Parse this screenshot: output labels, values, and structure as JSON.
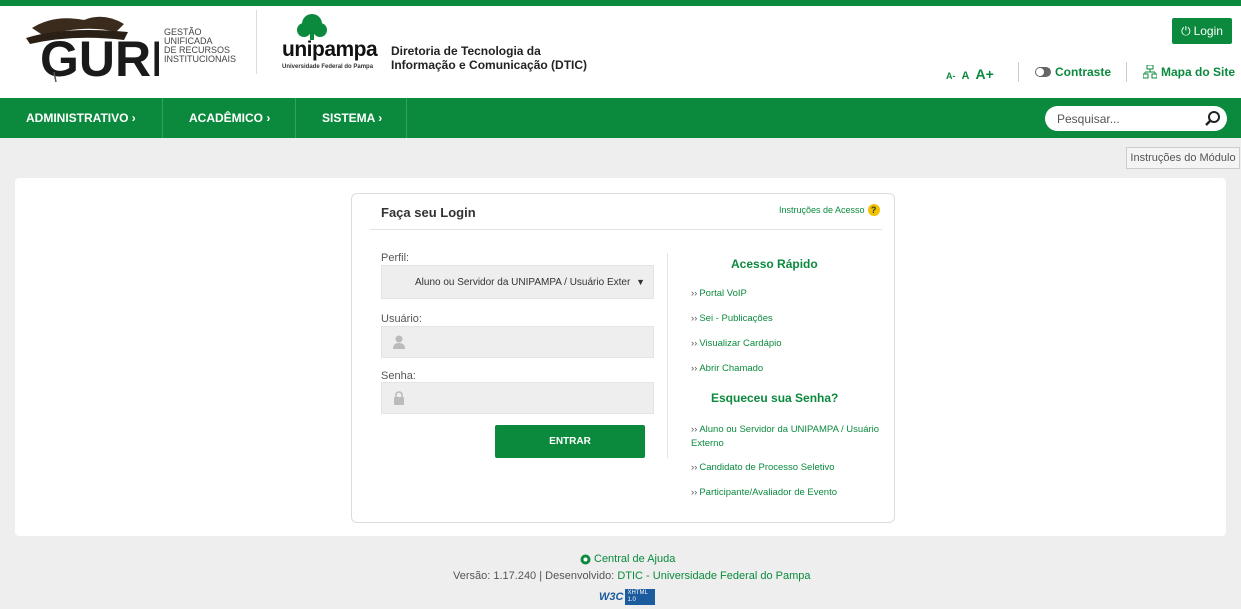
{
  "header": {
    "guri_wordmark": "GURI",
    "guri_subtitle": [
      "GESTÃO",
      "UNIFICADA",
      "DE RECURSOS",
      "INSTITUCIONAIS"
    ],
    "unipampa_wordmark": "unipampa",
    "unipampa_subtitle": "Universidade Federal do Pampa",
    "dtic_line1": "Diretoria de Tecnologia da",
    "dtic_line2": "Informação e Comunicação (DTIC)",
    "login_label": "Login",
    "font_small": "A-",
    "font_normal": "A",
    "font_large": "A+",
    "contraste_label": "Contraste",
    "mapa_label": "Mapa do Site"
  },
  "nav": {
    "items": [
      "ADMINISTRATIVO ›",
      "ACADÊMICO ›",
      "SISTEMA ›"
    ],
    "search_placeholder": "Pesquisar..."
  },
  "instrucoes_modulo": "Instruções do Módulo",
  "login_form": {
    "title": "Faça seu Login",
    "instrucoes_acesso": "Instruções de Acesso",
    "help_mark": "?",
    "perfil_label": "Perfil:",
    "perfil_value": "Aluno ou Servidor da UNIPAMPA / Usuário Exter",
    "usuario_label": "Usuário:",
    "senha_label": "Senha:",
    "entrar_label": "ENTRAR"
  },
  "quick_access": {
    "title": "Acesso Rápido",
    "links": [
      "Portal VoIP",
      "Sei - Publicações",
      "Visualizar Cardápio",
      "Abrir Chamado"
    ],
    "forgot_title": "Esqueceu sua Senha?",
    "forgot_links": [
      "Aluno ou Servidor da UNIPAMPA / Usuário Externo",
      "Candidato de Processo Seletivo",
      "Participante/Avaliador de Evento"
    ]
  },
  "footer": {
    "help_label": "Central de Ajuda",
    "version_prefix": "Versão: 1.17.240 | Desenvolvido:",
    "developer": "DTIC - Universidade Federal do Pampa",
    "badge_w3c": "W3C",
    "badge_xhtml": "XHTML 1.0"
  },
  "colors": {
    "brand_green": "#0b8a3e",
    "help_yellow": "#f2c200"
  }
}
